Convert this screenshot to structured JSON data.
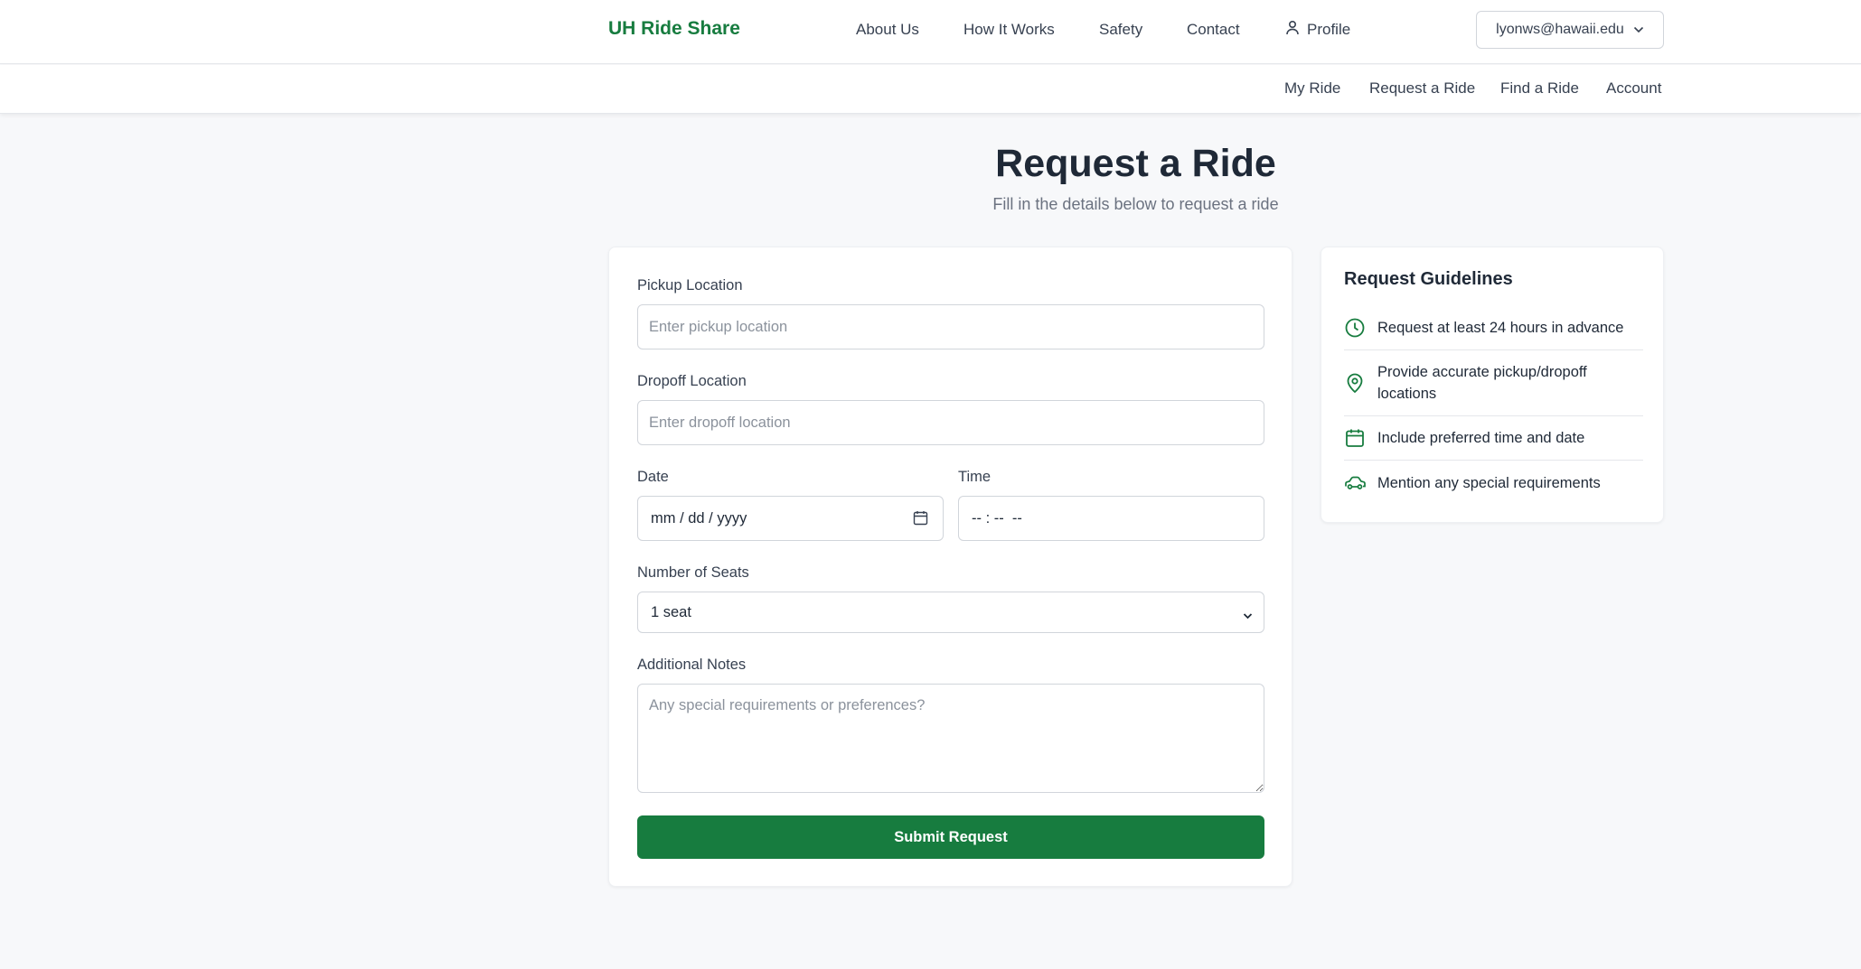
{
  "header": {
    "brand": "UH Ride Share",
    "nav": [
      "About Us",
      "How It Works",
      "Safety",
      "Contact"
    ],
    "profile_label": "Profile",
    "user_email": "lyonws@hawaii.edu"
  },
  "subnav": [
    "My Ride",
    "Request a Ride",
    "Find a Ride",
    "Account"
  ],
  "main": {
    "title": "Request a Ride",
    "subtitle": "Fill in the details below to request a ride"
  },
  "form": {
    "pickup": {
      "label": "Pickup Location",
      "placeholder": "Enter pickup location",
      "value": ""
    },
    "dropoff": {
      "label": "Dropoff Location",
      "placeholder": "Enter dropoff location",
      "value": ""
    },
    "date": {
      "label": "Date",
      "placeholder": "mm / dd / yyyy"
    },
    "time": {
      "label": "Time",
      "placeholder": "-- : --  --"
    },
    "seats": {
      "label": "Number of Seats",
      "value": "1 seat"
    },
    "notes": {
      "label": "Additional Notes",
      "placeholder": "Any special requirements or preferences?",
      "value": ""
    },
    "submit_label": "Submit Request"
  },
  "guidelines": {
    "title": "Request Guidelines",
    "items": [
      {
        "icon": "clock-icon",
        "text": "Request at least 24 hours in advance"
      },
      {
        "icon": "map-pin-icon",
        "text": "Provide accurate pickup/dropoff locations"
      },
      {
        "icon": "calendar-icon",
        "text": "Include preferred time and date"
      },
      {
        "icon": "car-icon",
        "text": "Mention any special requirements"
      }
    ]
  },
  "colors": {
    "brand": "#177c3f",
    "background": "#f7f8fa",
    "text": "#1f2937"
  }
}
